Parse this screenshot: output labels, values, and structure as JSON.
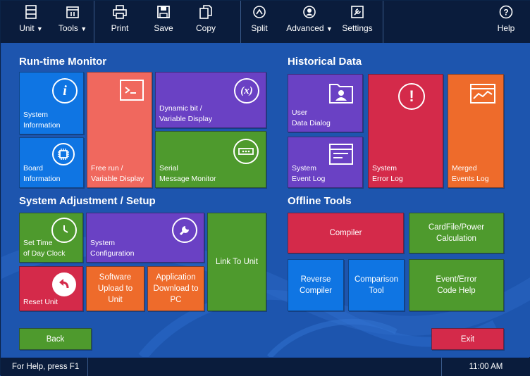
{
  "toolbar": {
    "unit": "Unit",
    "tools": "Tools",
    "print": "Print",
    "save": "Save",
    "copy": "Copy",
    "split": "Split",
    "advanced": "Advanced",
    "settings": "Settings",
    "help": "Help",
    "dropdown_glyph": "▼"
  },
  "sections": {
    "runtime": "Run-time Monitor",
    "historical": "Historical Data",
    "adjustment": "System Adjustment / Setup",
    "offline": "Offline Tools"
  },
  "tiles": {
    "system_information": [
      "System",
      "Information"
    ],
    "free_run": [
      "Free run /",
      "Variable Display"
    ],
    "dynamic_bit": [
      "Dynamic bit /",
      "Variable Display"
    ],
    "board_information": [
      "Board",
      "Information"
    ],
    "serial_monitor": [
      "Serial",
      "Message Monitor"
    ],
    "user_data": [
      "User",
      "Data Dialog"
    ],
    "system_error_log": [
      "System",
      "Error Log"
    ],
    "merged_events_log": [
      "Merged",
      "Events Log"
    ],
    "system_event_log": [
      "System",
      "Event Log"
    ],
    "set_time": [
      "Set Time",
      "of Day Clock"
    ],
    "system_configuration": [
      "System",
      "Configuration"
    ],
    "link_to_unit": "Link To Unit",
    "reset_unit": "Reset Unit",
    "software_upload": [
      "Software",
      "Upload to",
      "Unit"
    ],
    "application_download": [
      "Application",
      "Download to",
      "PC"
    ],
    "compiler": "Compiler",
    "cardfile": [
      "CardFile/Power",
      "Calculation"
    ],
    "reverse_compiler": [
      "Reverse",
      "Compiler"
    ],
    "comparison_tool": [
      "Comparison",
      "Tool"
    ],
    "event_error_help": [
      "Event/Error",
      "Code Help"
    ]
  },
  "buttons": {
    "back": "Back",
    "exit": "Exit"
  },
  "status": {
    "help_text": "For Help, press F1",
    "time": "11:00 AM"
  },
  "colors": {
    "blue": "#0f75e3",
    "salmon": "#f0685e",
    "purple": "#6a41c4",
    "green": "#4e9a2d",
    "crimson": "#d42a4a",
    "orange": "#ee6b2b",
    "toolbar": "#0a1c3c",
    "background": "#1d55ae"
  }
}
